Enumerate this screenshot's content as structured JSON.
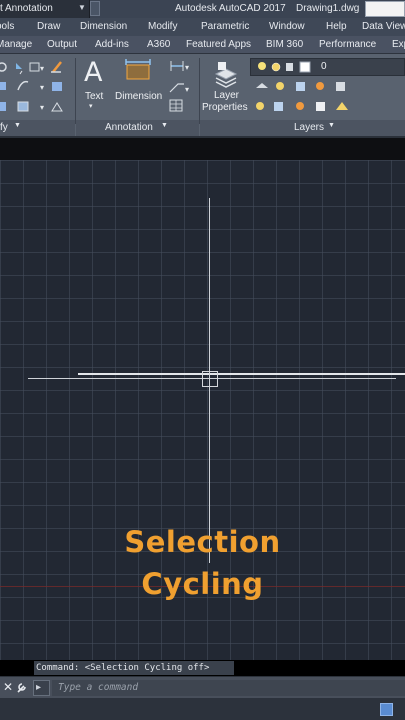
{
  "titlebar": {
    "workspace": "t Annotation",
    "app_title": "Autodesk AutoCAD 2017",
    "document_title": "Drawing1.dwg"
  },
  "menu": {
    "items": [
      "ools",
      "Draw",
      "Dimension",
      "Modify",
      "Parametric",
      "Window",
      "Help",
      "Data View"
    ]
  },
  "tabs": {
    "items": [
      "Manage",
      "Output",
      "Add-ins",
      "A360",
      "Featured Apps",
      "BIM 360",
      "Performance",
      "Exp"
    ]
  },
  "ribbon": {
    "text_label": "Text",
    "dimension_label": "Dimension",
    "layer_properties_line1": "Layer",
    "layer_properties_line2": "Properties",
    "layer_value": "0",
    "modify_panel": "fy",
    "annotation_panel": "Annotation",
    "layers_panel": "Layers"
  },
  "overlay": {
    "line1": "Selection",
    "line2": "Cycling"
  },
  "command": {
    "history": "Command:  <Selection Cycling off>",
    "placeholder": "Type a command"
  },
  "colors": {
    "overlay_text": "#f0a030",
    "canvas": "#222833",
    "ribbon": "#59626f"
  }
}
